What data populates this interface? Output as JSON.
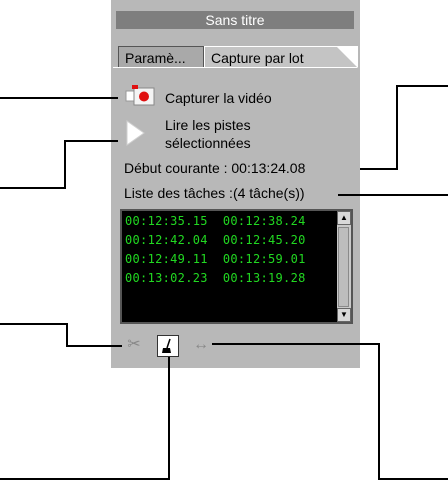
{
  "window": {
    "title": "Sans titre"
  },
  "tabs": [
    {
      "label": "Paramè..."
    },
    {
      "label": "Capture par lot"
    }
  ],
  "capture_button": {
    "label": "Capturer la vidéo",
    "icon": "camera-record-icon"
  },
  "play_button": {
    "label_line1": "Lire les pistes",
    "label_line2": "sélectionnées",
    "icon": "play-triangle-icon"
  },
  "start_time": {
    "text": "Début courante : 00:13:24.08"
  },
  "task_list": {
    "header": "Liste des tâches :(4 tâche(s))",
    "rows": [
      {
        "start": "00:12:35.15",
        "end": "00:12:38.24"
      },
      {
        "start": "00:12:42.04",
        "end": "00:12:45.20"
      },
      {
        "start": "00:12:49.11",
        "end": "00:12:59.01"
      },
      {
        "start": "00:13:02.23",
        "end": "00:13:19.28"
      }
    ]
  },
  "toolbar": [
    {
      "icon": "scissors-icon",
      "glyph": "✂",
      "active": false
    },
    {
      "icon": "broom-icon",
      "glyph": "⌇",
      "active": true
    },
    {
      "icon": "double-arrow-icon",
      "glyph": "↔",
      "active": false
    }
  ],
  "colors": {
    "panel_bg": "#b8b8b8",
    "title_bg": "#7e7e7e",
    "timecode_green": "#21d821",
    "record_red": "#e01010"
  }
}
